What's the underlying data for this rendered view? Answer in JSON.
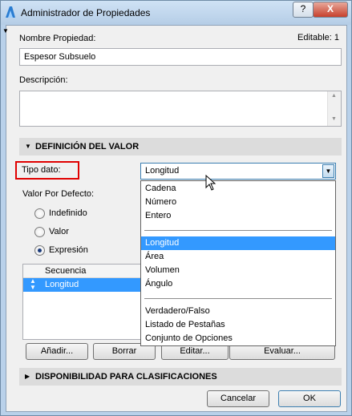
{
  "window": {
    "title": "Administrador de Propiedades",
    "help_label": "?",
    "close_label": "X"
  },
  "editable_label": "Editable: 1",
  "property_name": {
    "label": "Nombre Propiedad:",
    "value": "Espesor Subsuelo"
  },
  "description": {
    "label": "Descripción:",
    "value": ""
  },
  "value_definition": {
    "header": "DEFINICIÓN DEL VALOR",
    "type_label": "Tipo dato:",
    "type_value": "Longitud",
    "default_label": "Valor Por Defecto:",
    "radios": [
      {
        "label": "Indefinido",
        "checked": false
      },
      {
        "label": "Valor",
        "checked": false
      },
      {
        "label": "Expresión",
        "checked": true
      }
    ],
    "list_header": "Secuencia",
    "list_row": "Longitud",
    "buttons": {
      "add": "Añadir...",
      "delete": "Borrar",
      "edit": "Editar...",
      "evaluate": "Evaluar..."
    }
  },
  "dropdown_options": [
    "Cadena",
    "Número",
    "Entero",
    "Longitud",
    "Área",
    "Volumen",
    "Ángulo",
    "Verdadero/Falso",
    "Listado de Pestañas",
    "Conjunto de Opciones"
  ],
  "selected_option": "Longitud",
  "availability": {
    "header": "DISPONIBILIDAD PARA CLASIFICACIONES"
  },
  "footer": {
    "cancel": "Cancelar",
    "ok": "OK"
  },
  "colors": {
    "selection": "#3399ff",
    "highlight_box": "#e00000"
  }
}
